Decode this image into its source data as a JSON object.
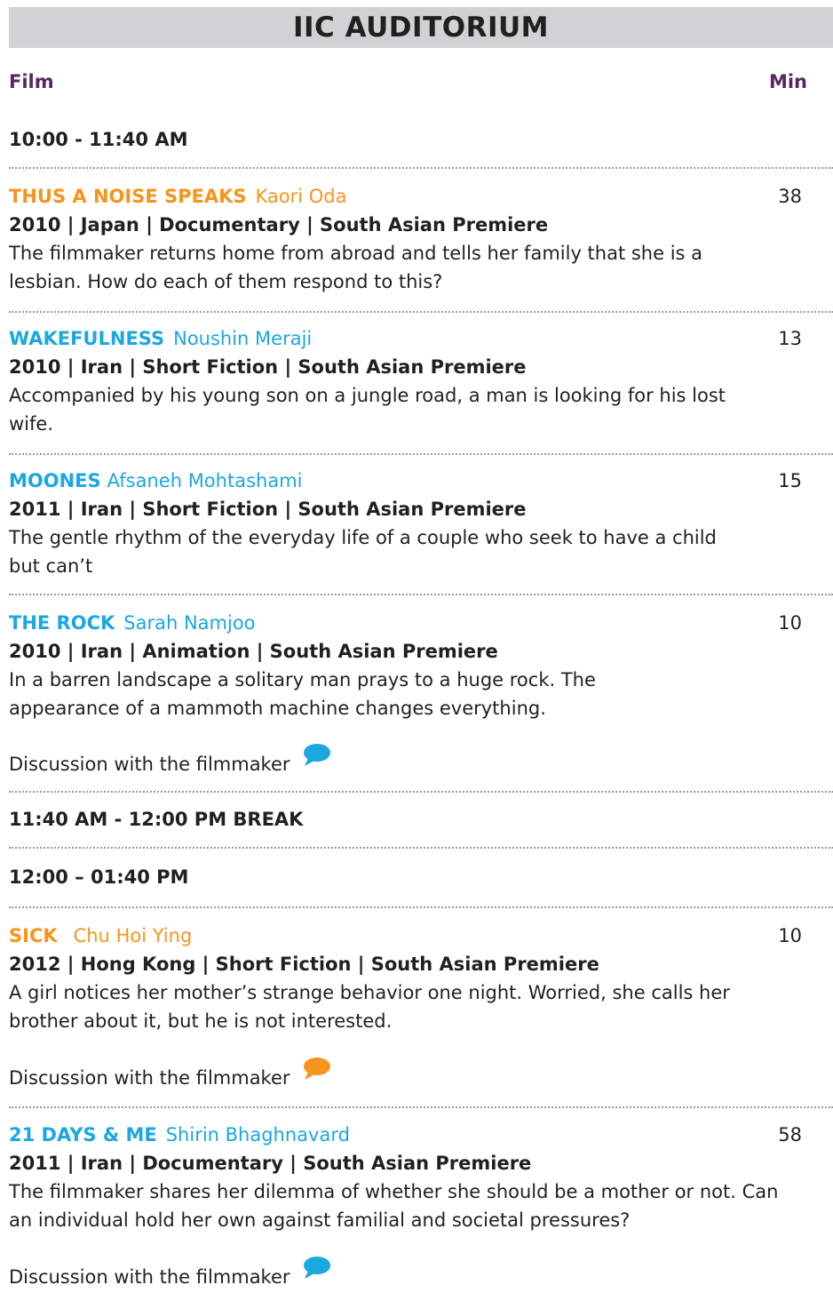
{
  "header": {
    "title": "IIC AUDITORIUM"
  },
  "columns": {
    "film": "Film",
    "min": "Min"
  },
  "colors": {
    "orange": "#f7941d",
    "blue": "#1ba7e0",
    "purple": "#55285f",
    "banner": "#d1d2d4"
  },
  "slots": [
    {
      "label": "10:00 - 11:40 AM"
    },
    {
      "label": "11:40 AM - 12:00 PM BREAK"
    },
    {
      "label": "12:00 – 01:40 PM"
    }
  ],
  "films": [
    {
      "title": "THUS A NOISE SPEAKS",
      "director": "Kaori Oda",
      "minutes": "38",
      "meta": "2010 | Japan | Documentary | South Asian Premiere",
      "desc": "The filmmaker returns home from abroad and tells her family that she is a lesbian. How do each of them respond to this?"
    },
    {
      "title": "WAKEFULNESS",
      "director": "Noushin Meraji",
      "minutes": "13",
      "meta": "2010 | Iran | Short Fiction | South Asian Premiere",
      "desc": "Accompanied by his young son on a jungle road, a man is looking for his lost wife."
    },
    {
      "title": "MOONES",
      "director": "Afsaneh Mohtashami",
      "minutes": "15",
      "meta": "2011 | Iran | Short Fiction | South Asian Premiere",
      "desc": "The gentle rhythm of the everyday life of a couple who seek to have a child but can’t"
    },
    {
      "title": "THE ROCK",
      "director": "Sarah Namjoo",
      "minutes": "10",
      "meta": "2010 | Iran | Animation | South Asian Premiere",
      "desc": "In a barren landscape a solitary man prays to a huge rock. The appearance of a mammoth machine changes everything."
    },
    {
      "title": "SICK",
      "director": "Chu Hoi Ying",
      "minutes": "10",
      "meta": "2012 | Hong Kong | Short Fiction | South Asian Premiere",
      "desc": "A girl notices her mother’s strange behavior one night. Worried, she calls her brother about it, but he is not interested."
    },
    {
      "title": "21 DAYS & ME",
      "director": "Shirin Bhaghnavard",
      "minutes": "58",
      "meta": "2011 | Iran | Documentary | South Asian Premiere",
      "desc": "The filmmaker shares her dilemma of whether she should be a mother or not. Can an individual hold her own against familial and societal pressures?"
    }
  ],
  "discussion": {
    "label": "Discussion with the filmmaker",
    "icon": "speech-bubble-icon"
  }
}
